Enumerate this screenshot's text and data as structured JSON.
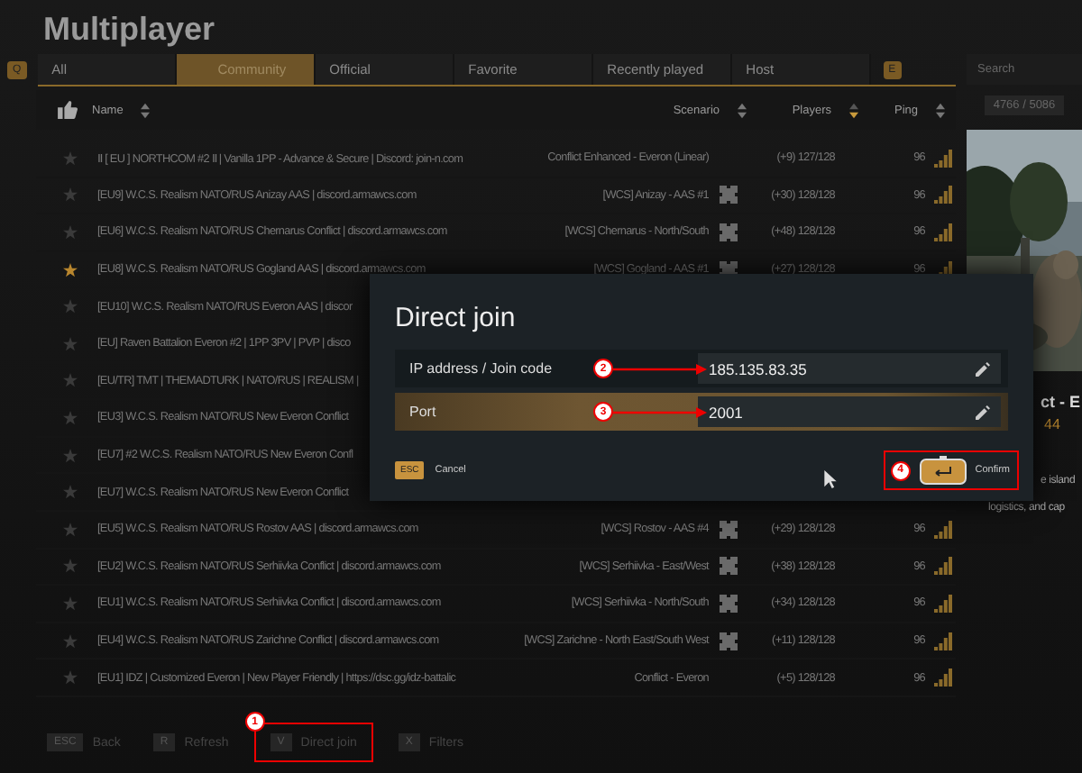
{
  "title": "Multiplayer",
  "tab_prev_key": "Q",
  "tab_next_key": "E",
  "tabs": [
    {
      "label": "All",
      "selected": false
    },
    {
      "label": "Community",
      "selected": true
    },
    {
      "label": "Official",
      "selected": false
    },
    {
      "label": "Favorite",
      "selected": false
    },
    {
      "label": "Recently played",
      "selected": false
    },
    {
      "label": "Host",
      "selected": false
    }
  ],
  "search": {
    "placeholder": "Search"
  },
  "server_count": "4766 / 5086",
  "columns": [
    {
      "label": "Name",
      "kind": "name",
      "sorted": false
    },
    {
      "label": "Scenario",
      "kind": "scenario",
      "sorted": false
    },
    {
      "label": "Players",
      "kind": "players",
      "sorted": true
    },
    {
      "label": "Ping",
      "kind": "ping",
      "sorted": false
    }
  ],
  "rows": [
    {
      "favorite": false,
      "name": "Ⅱ [ EU ] NORTHCOM #2 Ⅱ | Vanilla 1PP - Advance & Secure | Discord: join-n.com",
      "scenario": "Conflict Enhanced - Everon (Linear)",
      "modded": false,
      "players": "(+9) 127/128",
      "ping": "96"
    },
    {
      "favorite": false,
      "name": "[EU9] W.C.S. Realism NATO/RUS Anizay AAS | discord.armawcs.com",
      "scenario": "[WCS] Anizay - AAS #1",
      "modded": true,
      "players": "(+30) 128/128",
      "ping": "96"
    },
    {
      "favorite": false,
      "name": "[EU6] W.C.S. Realism NATO/RUS Chernarus Conflict | discord.armawcs.com",
      "scenario": "[WCS] Chernarus - North/South",
      "modded": true,
      "players": "(+48) 128/128",
      "ping": "96"
    },
    {
      "favorite": true,
      "name": "[EU8] W.C.S. Realism NATO/RUS Gogland AAS | discord.armawcs.com",
      "scenario": "[WCS] Gogland - AAS #1",
      "modded": true,
      "players": "(+27) 128/128",
      "ping": "96"
    },
    {
      "favorite": false,
      "name": "[EU10] W.C.S. Realism NATO/RUS Everon AAS | discor"
    },
    {
      "favorite": false,
      "name": "[EU] Raven Battalion Everon #2 | 1PP 3PV | PVP | disco"
    },
    {
      "favorite": false,
      "name": "[EU/TR] TMT | THEMADTURK | NATO/RUS | REALISM |"
    },
    {
      "favorite": false,
      "name": "[EU3] W.C.S. Realism NATO/RUS New Everon Conflict"
    },
    {
      "favorite": false,
      "name": "[EU7] #2 W.C.S. Realism NATO/RUS New Everon Confl"
    },
    {
      "favorite": false,
      "name": "[EU7] W.C.S. Realism NATO/RUS New Everon Conflict"
    },
    {
      "favorite": false,
      "name": "[EU5] W.C.S. Realism NATO/RUS Rostov AAS | discord.armawcs.com",
      "scenario": "[WCS] Rostov - AAS #4",
      "modded": true,
      "players": "(+29) 128/128",
      "ping": "96"
    },
    {
      "favorite": false,
      "name": "[EU2] W.C.S. Realism NATO/RUS Serhiivka Conflict | discord.armawcs.com",
      "scenario": "[WCS] Serhiivka - East/West",
      "modded": true,
      "players": "(+38) 128/128",
      "ping": "96"
    },
    {
      "favorite": false,
      "name": "[EU1] W.C.S. Realism NATO/RUS Serhiivka Conflict | discord.armawcs.com",
      "scenario": "[WCS] Serhiivka - North/South",
      "modded": true,
      "players": "(+34) 128/128",
      "ping": "96"
    },
    {
      "favorite": false,
      "name": "[EU4] W.C.S. Realism NATO/RUS Zarichne Conflict | discord.armawcs.com",
      "scenario": "[WCS] Zarichne - North East/South West",
      "modded": true,
      "players": "(+11) 128/128",
      "ping": "96"
    },
    {
      "favorite": false,
      "name": "[EU1] IDZ | Customized Everon | New Player Friendly | https://dsc.gg/idz-battalic",
      "scenario": "Conflict - Everon",
      "modded": false,
      "players": "(+5) 128/128",
      "ping": "96"
    }
  ],
  "details": {
    "title": "ct - E",
    "rating": "44",
    "lines": [
      "e island",
      "logistics, and cap"
    ]
  },
  "dialog": {
    "title": "Direct join",
    "fields": [
      {
        "label": "IP address / Join code",
        "value": "185.135.83.35",
        "selected": false,
        "annotation": "2"
      },
      {
        "label": "Port",
        "value": "2001",
        "selected": true,
        "annotation": "3"
      }
    ],
    "cancel": {
      "key": "ESC",
      "label": "Cancel"
    },
    "confirm": {
      "label": "Confirm",
      "annotation": "4"
    }
  },
  "bottom_bar": [
    {
      "key": "ESC",
      "label": "Back"
    },
    {
      "key": "R",
      "label": "Refresh"
    },
    {
      "key": "V",
      "label": "Direct join",
      "annotation": "1"
    },
    {
      "key": "X",
      "label": "Filters"
    }
  ]
}
